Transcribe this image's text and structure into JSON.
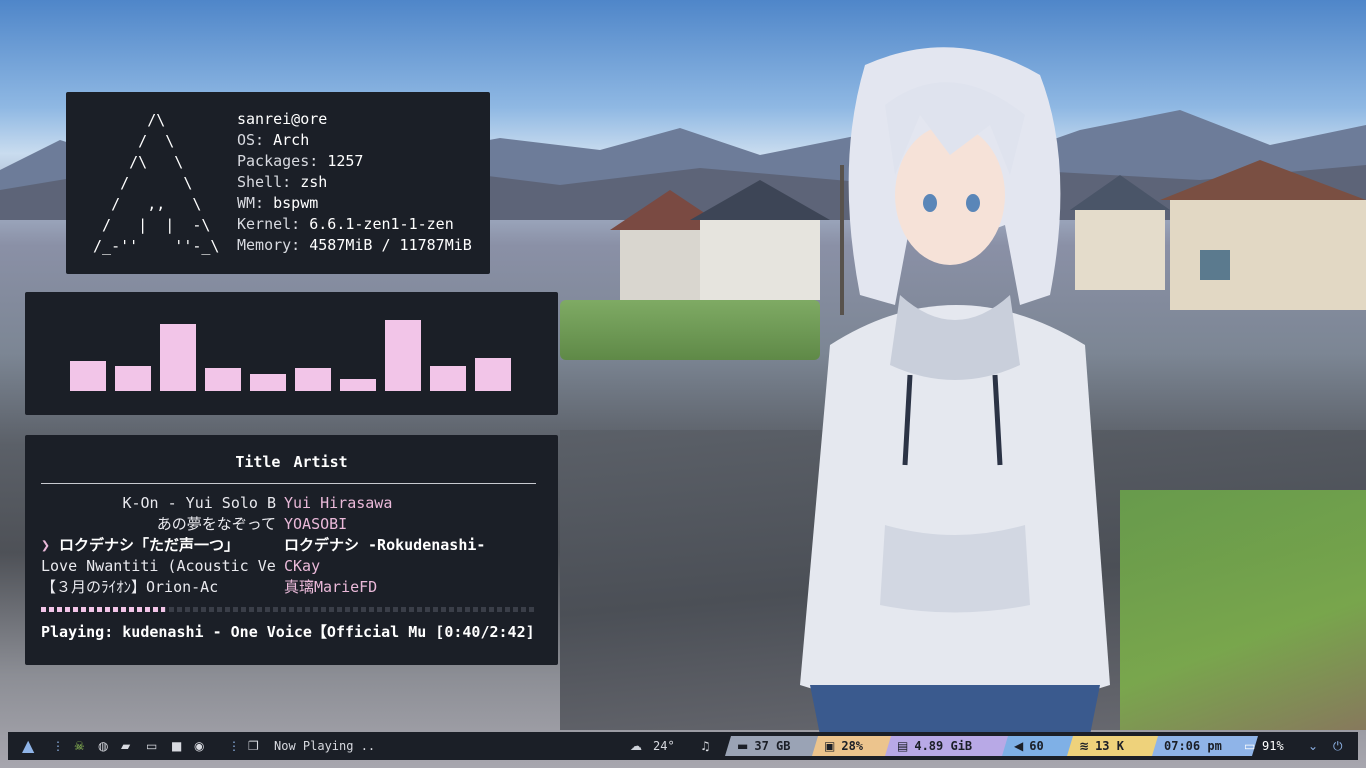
{
  "fetch": {
    "logo": "       /\\\n      /  \\\n     /\\   \\\n    /      \\\n   /   ,,   \\\n  /   |  |  -\\\n /_-''    ''-_\\",
    "user": "sanrei@ore",
    "rows": [
      {
        "key": "OS:",
        "value": "Arch"
      },
      {
        "key": "Packages:",
        "value": "1257"
      },
      {
        "key": "Shell:",
        "value": "zsh"
      },
      {
        "key": "WM:",
        "value": "bspwm"
      },
      {
        "key": "Kernel:",
        "value": "6.6.1-zen1-1-zen"
      },
      {
        "key": "Memory:",
        "value": "4587MiB / 11787MiB"
      }
    ]
  },
  "visualizer": {
    "bar_color": "#f2c5e8",
    "levels": [
      0.3,
      0.25,
      0.67,
      0.23,
      0.17,
      0.23,
      0.12,
      0.71,
      0.25,
      0.33
    ]
  },
  "player": {
    "col_title": "Title",
    "col_artist": "Artist",
    "tracks": [
      {
        "title": "K-On - Yui Solo B",
        "artist": "Yui Hirasawa",
        "align": "right",
        "active": false
      },
      {
        "title": "あの夢をなぞって",
        "artist": "YOASOBI",
        "align": "right",
        "active": false
      },
      {
        "title": "ロクデナシ「ただ声一つ」",
        "artist": "ロクデナシ -Rokudenashi-",
        "align": "left",
        "active": true,
        "marker": "❯"
      },
      {
        "title": "Love Nwantiti (Acoustic Ve",
        "artist": "CKay",
        "align": "left",
        "active": false
      },
      {
        "title": "【３月のﾗｲｵﾝ】Orion-Ac",
        "artist": "真璃MarieFD",
        "align": "left",
        "active": false
      }
    ],
    "progress": 0.25,
    "status": "Playing: kudenashi - One Voice【Official Mu [0:40/2:42]"
  },
  "taskbar": {
    "left_icons": [
      "arch-icon",
      "dots-icon",
      "skull-icon",
      "globe-icon",
      "folder-icon",
      "terminal-icon",
      "chat-icon",
      "gamepad-icon",
      "dots-icon"
    ],
    "now_playing": "Now Playing ..",
    "weather": "24°",
    "disk": "37 GB",
    "cpu": "28%",
    "ram": "4.89 GiB",
    "volume": "60",
    "network": "13 K",
    "time": "07:06 pm",
    "battery": "91%",
    "colors": {
      "disk": "#9aa3b5",
      "cpu": "#ecc48d",
      "ram": "#b8a9e6",
      "volume": "#7fb0e6",
      "network": "#eed27b",
      "time": "#8fb4e8",
      "battery": "#ffffff",
      "accent": "#8fb4e8"
    }
  }
}
